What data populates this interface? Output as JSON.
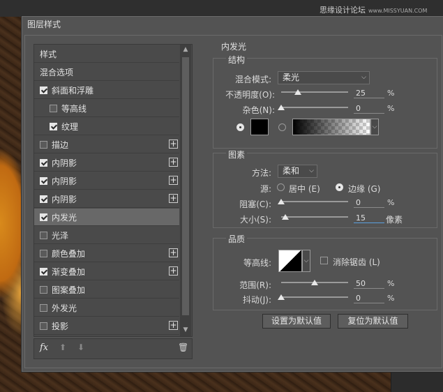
{
  "watermark": {
    "main": "思缘设计论坛",
    "small": "www.MISSYUAN.COM"
  },
  "dialog_title": "图层样式",
  "style_list": {
    "items": [
      {
        "label": "样式",
        "checkbox": false,
        "checked": false,
        "plus": false,
        "selected": false,
        "indent": 0
      },
      {
        "label": "混合选项",
        "checkbox": false,
        "checked": false,
        "plus": false,
        "selected": false,
        "indent": 0
      },
      {
        "label": "斜面和浮雕",
        "checkbox": true,
        "checked": true,
        "plus": false,
        "selected": false,
        "indent": 0
      },
      {
        "label": "等高线",
        "checkbox": true,
        "checked": false,
        "plus": false,
        "selected": false,
        "indent": 1
      },
      {
        "label": "纹理",
        "checkbox": true,
        "checked": true,
        "plus": false,
        "selected": false,
        "indent": 1
      },
      {
        "label": "描边",
        "checkbox": true,
        "checked": false,
        "plus": true,
        "selected": false,
        "indent": 0
      },
      {
        "label": "内阴影",
        "checkbox": true,
        "checked": true,
        "plus": true,
        "selected": false,
        "indent": 0
      },
      {
        "label": "内阴影",
        "checkbox": true,
        "checked": true,
        "plus": true,
        "selected": false,
        "indent": 0
      },
      {
        "label": "内阴影",
        "checkbox": true,
        "checked": true,
        "plus": true,
        "selected": false,
        "indent": 0
      },
      {
        "label": "内发光",
        "checkbox": true,
        "checked": true,
        "plus": false,
        "selected": true,
        "indent": 0
      },
      {
        "label": "光泽",
        "checkbox": true,
        "checked": false,
        "plus": false,
        "selected": false,
        "indent": 0
      },
      {
        "label": "颜色叠加",
        "checkbox": true,
        "checked": false,
        "plus": true,
        "selected": false,
        "indent": 0
      },
      {
        "label": "渐变叠加",
        "checkbox": true,
        "checked": true,
        "plus": true,
        "selected": false,
        "indent": 0
      },
      {
        "label": "图案叠加",
        "checkbox": true,
        "checked": false,
        "plus": false,
        "selected": false,
        "indent": 0
      },
      {
        "label": "外发光",
        "checkbox": true,
        "checked": false,
        "plus": false,
        "selected": false,
        "indent": 0
      },
      {
        "label": "投影",
        "checkbox": true,
        "checked": false,
        "plus": true,
        "selected": false,
        "indent": 0
      }
    ],
    "footer": {
      "fx": "fx",
      "up": "⬆",
      "down": "⬇",
      "trash": "🗑"
    }
  },
  "panel": {
    "title": "内发光",
    "structure": {
      "title": "结构",
      "blend_mode_label": "混合模式:",
      "blend_mode_value": "柔光",
      "opacity_label": "不透明度(O):",
      "opacity_value": "25",
      "opacity_level": 25,
      "noise_label": "杂色(N):",
      "noise_value": "0",
      "noise_level": 0,
      "percent": "%",
      "color": "#000000"
    },
    "elements": {
      "title": "图素",
      "method_label": "方法:",
      "method_value": "柔和",
      "source_label": "源:",
      "source_center": "居中 (E)",
      "source_edge": "边缘 (G)",
      "choke_label": "阻塞(C):",
      "choke_value": "0",
      "choke_level": 0,
      "size_label": "大小(S):",
      "size_value": "15",
      "size_level": 6,
      "size_unit": "像素",
      "percent": "%"
    },
    "quality": {
      "title": "品质",
      "contour_label": "等高线:",
      "antialias_label": "消除锯齿 (L)",
      "range_label": "范围(R):",
      "range_value": "50",
      "range_level": 50,
      "jitter_label": "抖动(J):",
      "jitter_value": "0",
      "jitter_level": 0,
      "percent": "%"
    },
    "buttons": {
      "set_default": "设置为默认值",
      "reset_default": "复位为默认值"
    }
  }
}
